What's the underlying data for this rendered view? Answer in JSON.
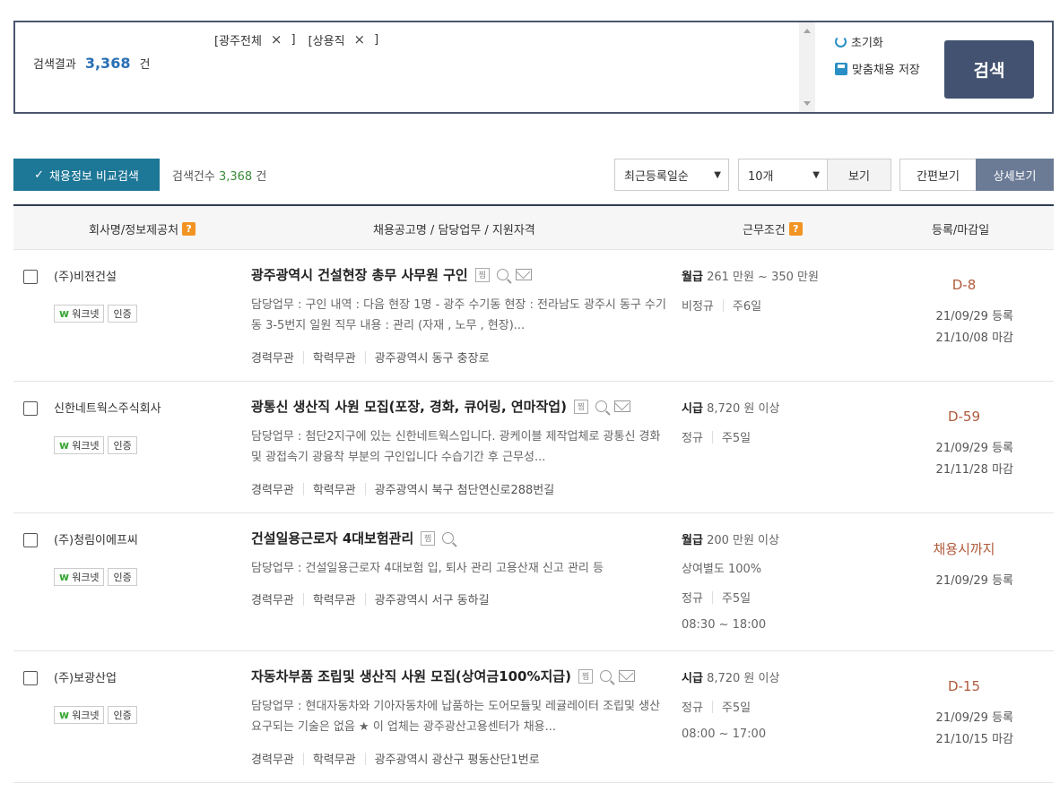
{
  "search_box": {
    "result_label": "검색결과",
    "result_count": "3,368",
    "result_unit": "건",
    "chips": [
      {
        "label": "[광주전체",
        "close": "×",
        "bracket": "]"
      },
      {
        "label": "[상용직",
        "close": "×",
        "bracket": "]"
      }
    ],
    "reset_label": "초기화",
    "save_label": "맞춤채용 저장",
    "search_button": "검색"
  },
  "toolbar": {
    "compare_button": "채용정보 비교검색",
    "compare_check": "✓",
    "count_label": "검색건수",
    "count_value": "3,368",
    "count_unit": "건",
    "sort_selected": "최근등록일순",
    "per_page_selected": "10개",
    "view_button": "보기",
    "simple_view": "간편보기",
    "detail_view": "상세보기"
  },
  "table": {
    "headers": {
      "company": "회사명/정보제공처",
      "title": "채용공고명 / 담당업무 / 지원자격",
      "conditions": "근무조건",
      "dates": "등록/마감일"
    },
    "help_icon": "?",
    "badge_worknet": "워크넷",
    "badge_cert": "인증",
    "scrap_icon": "찜",
    "rows": [
      {
        "company": "(주)비젼건설",
        "title": "광주광역시 건설현장 총무 사무원 구인",
        "desc": "담당업무 : 구인 내역 : 다음 현장 1명 - 광주 수기동 현장 : 전라남도 광주시 동구 수기동 3-5번지 일원 직무 내용 : 관리 (자재 , 노무 , 현장)...",
        "tags": [
          "경력무관",
          "학력무관",
          "광주광역시 동구 충장로"
        ],
        "pay_type": "월급",
        "pay": "261 만원 ~ 350 만원",
        "cond_extra": [],
        "emp": [
          "비정규",
          "주6일"
        ],
        "hours": "",
        "dday": "D-8",
        "registered": "21/09/29 등록",
        "deadline": "21/10/08 마감",
        "has_mail": true
      },
      {
        "company": "신한네트웍스주식회사",
        "title": "광통신 생산직 사원 모집(포장, 경화, 큐어링, 연마작업)",
        "desc": "담당업무 : 첨단2지구에 있는 신한네트웍스입니다. 광케이블 제작업체로 광통신 경화 및 광접속기 광융착 부분의 구인입니다 수습기간 후 근무성...",
        "tags": [
          "경력무관",
          "학력무관",
          "광주광역시 북구 첨단연신로288번길"
        ],
        "pay_type": "시급",
        "pay": "8,720 원 이상",
        "cond_extra": [],
        "emp": [
          "정규",
          "주5일"
        ],
        "hours": "",
        "dday": "D-59",
        "registered": "21/09/29 등록",
        "deadline": "21/11/28 마감",
        "has_mail": true
      },
      {
        "company": "(주)청림이에프씨",
        "title": "건설일용근로자 4대보험관리",
        "desc": "담당업무 : 건설일용근로자 4대보험 입, 퇴사 관리 고용산재 신고 관리 등",
        "tags": [
          "경력무관",
          "학력무관",
          "광주광역시 서구 동하길"
        ],
        "pay_type": "월급",
        "pay": "200 만원 이상",
        "cond_extra": [
          "상여별도 100%"
        ],
        "emp": [
          "정규",
          "주5일"
        ],
        "hours": "08:30 ~ 18:00",
        "dday": "채용시까지",
        "registered": "21/09/29 등록",
        "deadline": "",
        "has_mail": false
      },
      {
        "company": "(주)보광산업",
        "title": "자동차부품 조립및 생산직 사원 모집(상여금100%지급)",
        "desc": "담당업무 : 현대자동차와 기아자동차에 납품하는 도어모듈및 레귤레이터 조립및 생산 요구되는 기술은 없음 ★ 이 업체는 광주광산고용센터가 채용...",
        "tags": [
          "경력무관",
          "학력무관",
          "광주광역시 광산구 평동산단1번로"
        ],
        "pay_type": "시급",
        "pay": "8,720 원 이상",
        "cond_extra": [],
        "emp": [
          "정규",
          "주5일"
        ],
        "hours": "08:00 ~ 17:00",
        "dday": "D-15",
        "registered": "21/09/29 등록",
        "deadline": "21/10/15 마감",
        "has_mail": true
      }
    ]
  }
}
